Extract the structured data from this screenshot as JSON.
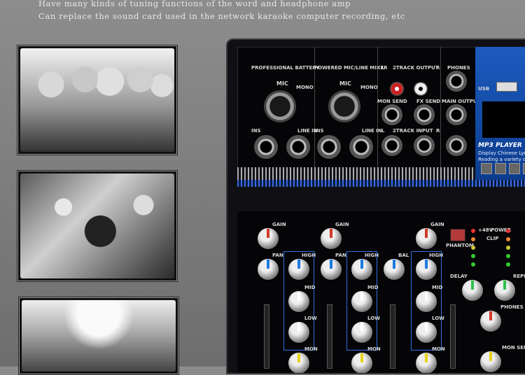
{
  "captions": {
    "line1": "Have many kinds of tuning functions of the word and headphone amp",
    "line2": "Can replace the sound card used in the network karaoke computer recording, etc"
  },
  "mixer": {
    "top_labels": {
      "professional_battery": "PROFESSIONAL BATTERY",
      "powered_mixer": "POWERED MIC/LINE MIXER",
      "track_output": "2TRACK  OUTPUT",
      "phones": "PHONES",
      "usb": "USB",
      "mic1": "MIC",
      "mono1": "MONO",
      "mic2": "MIC",
      "mono2": "MONO",
      "ins1": "INS",
      "linein1": "LINE IN",
      "ins2": "INS",
      "linein2": "LINE IN",
      "l1": "L",
      "r1": "R",
      "mon_send": "MON SEND",
      "fx_send": "FX SEND",
      "main_output": "MAIN OUTPUT",
      "track_input": "2TRACK INPUT",
      "l2": "L",
      "r2": "R"
    },
    "player": {
      "title": "MP3 PLAYER",
      "line1": "Display Chinese Lyric",
      "line2": "Reading a variety of format"
    },
    "lower_labels": {
      "gain": "GAIN",
      "pan": "PAN",
      "high": "HIGH",
      "mid": "MID",
      "low": "LOW",
      "mon": "MON",
      "bal": "BAL",
      "phantom": "PHANTOM",
      "p48v": "+48V",
      "power": "POWER",
      "clip": "CLIP",
      "delay": "DELAY",
      "repeat": "REPE",
      "phones": "PHONES",
      "mon_send": "MON SEND"
    },
    "colors": {
      "blue_accent": "#1c5bbf",
      "knob_blue": "#1e7be0",
      "knob_red": "#d23a2a",
      "knob_green": "#2fbf4a",
      "knob_yellow": "#e8d21a"
    }
  }
}
